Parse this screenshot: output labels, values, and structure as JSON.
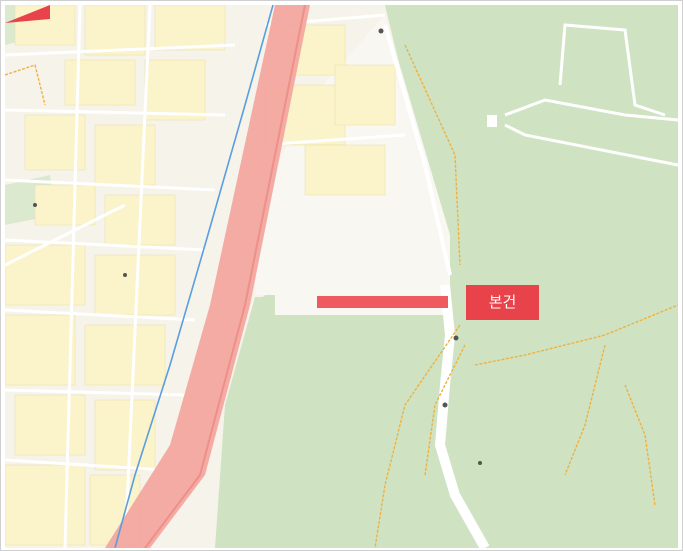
{
  "map": {
    "callout_label": "본건",
    "colors": {
      "park": "#cfe3c2",
      "urban": "#f6f3ea",
      "block": "#fbf3c9",
      "road_band": "#f2a7a0",
      "stream": "#5a9ee0",
      "trail": "#f0b040",
      "subject_bar": "#ee5a5f",
      "callout": "#e8434a"
    },
    "icons": [
      "pin-icon",
      "trail-path",
      "stream-line"
    ]
  }
}
